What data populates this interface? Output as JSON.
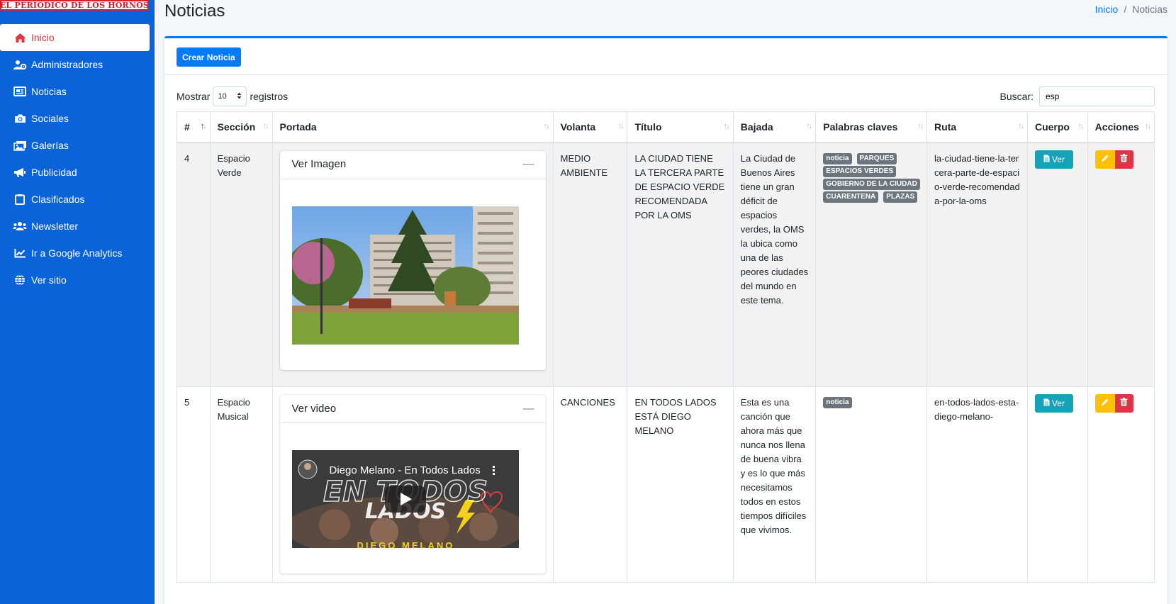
{
  "brand": {
    "logo_text": "EL PERIODICO DE LOS HORNOS"
  },
  "sidebar": {
    "items": [
      {
        "label": "Inicio",
        "icon": "home-icon",
        "active": true
      },
      {
        "label": "Administradores",
        "icon": "users-cog-icon"
      },
      {
        "label": "Noticias",
        "icon": "newspaper-icon"
      },
      {
        "label": "Sociales",
        "icon": "camera-icon"
      },
      {
        "label": "Galerías",
        "icon": "images-icon"
      },
      {
        "label": "Publicidad",
        "icon": "bullhorn-icon"
      },
      {
        "label": "Clasificados",
        "icon": "clipboard-icon"
      },
      {
        "label": "Newsletter",
        "icon": "users-icon"
      },
      {
        "label": "Ir a Google Analytics",
        "icon": "chart-line-icon"
      },
      {
        "label": "Ver sitio",
        "icon": "globe-icon"
      }
    ]
  },
  "header": {
    "title": "Noticias",
    "breadcrumb": {
      "home": "Inicio",
      "separator": "/",
      "current": "Noticias"
    }
  },
  "toolbar": {
    "create_label": "Crear Noticia"
  },
  "table_controls": {
    "show_prefix": "Mostrar",
    "show_value": "10",
    "show_suffix": "registros",
    "search_label": "Buscar:",
    "search_value": "esp"
  },
  "table": {
    "columns": [
      "#",
      "Sección",
      "Portada",
      "Volanta",
      "Título",
      "Bajada",
      "Palabras claves",
      "Ruta",
      "Cuerpo",
      "Acciones"
    ],
    "rows": [
      {
        "id": "4",
        "seccion": "Espacio Verde",
        "portada_label": "Ver Imagen",
        "volanta": "MEDIO AMBIENTE",
        "titulo": "LA CIUDAD TIENE LA TERCERA PARTE DE ESPACIO VERDE RECOMENDADA POR LA OMS",
        "bajada": "La Ciudad de Buenos Aires tiene un gran déficit de espacios verdes, la OMS la ubica como una de las peores ciudades del mundo en este tema.",
        "keywords": [
          "noticia",
          "PARQUES",
          "ESPACIOS VERDES",
          "GOBIERNO DE LA CIUDAD",
          "CUARENTENA",
          "PLAZAS"
        ],
        "ruta": "la-ciudad-tiene-la-tercera-parte-de-espacio-verde-recomendada-por-la-oms",
        "cuerpo_label": "Ver"
      },
      {
        "id": "5",
        "seccion": "Espacio Musical",
        "portada_label": "Ver video",
        "video_title": "Diego Melano - En Todos Lados",
        "video_caption": "DIEGO MELANO",
        "volanta": "CANCIONES",
        "titulo": "EN TODOS LADOS ESTÁ DIEGO MELANO",
        "bajada": "Esta es una canción que ahora más que nunca nos llena de buena vibra y es lo que más necesitamos todos en estos tiempos difíciles que vivimos.",
        "keywords": [
          "noticia"
        ],
        "ruta": "en-todos-lados-esta-diego-melano-",
        "cuerpo_label": "Ver"
      }
    ]
  },
  "colors": {
    "sidebar_bg": "#0b63d9",
    "primary": "#007bff",
    "info": "#17a2b8",
    "warning": "#ffc107",
    "danger": "#dc3545",
    "active_text": "#e1343f"
  }
}
